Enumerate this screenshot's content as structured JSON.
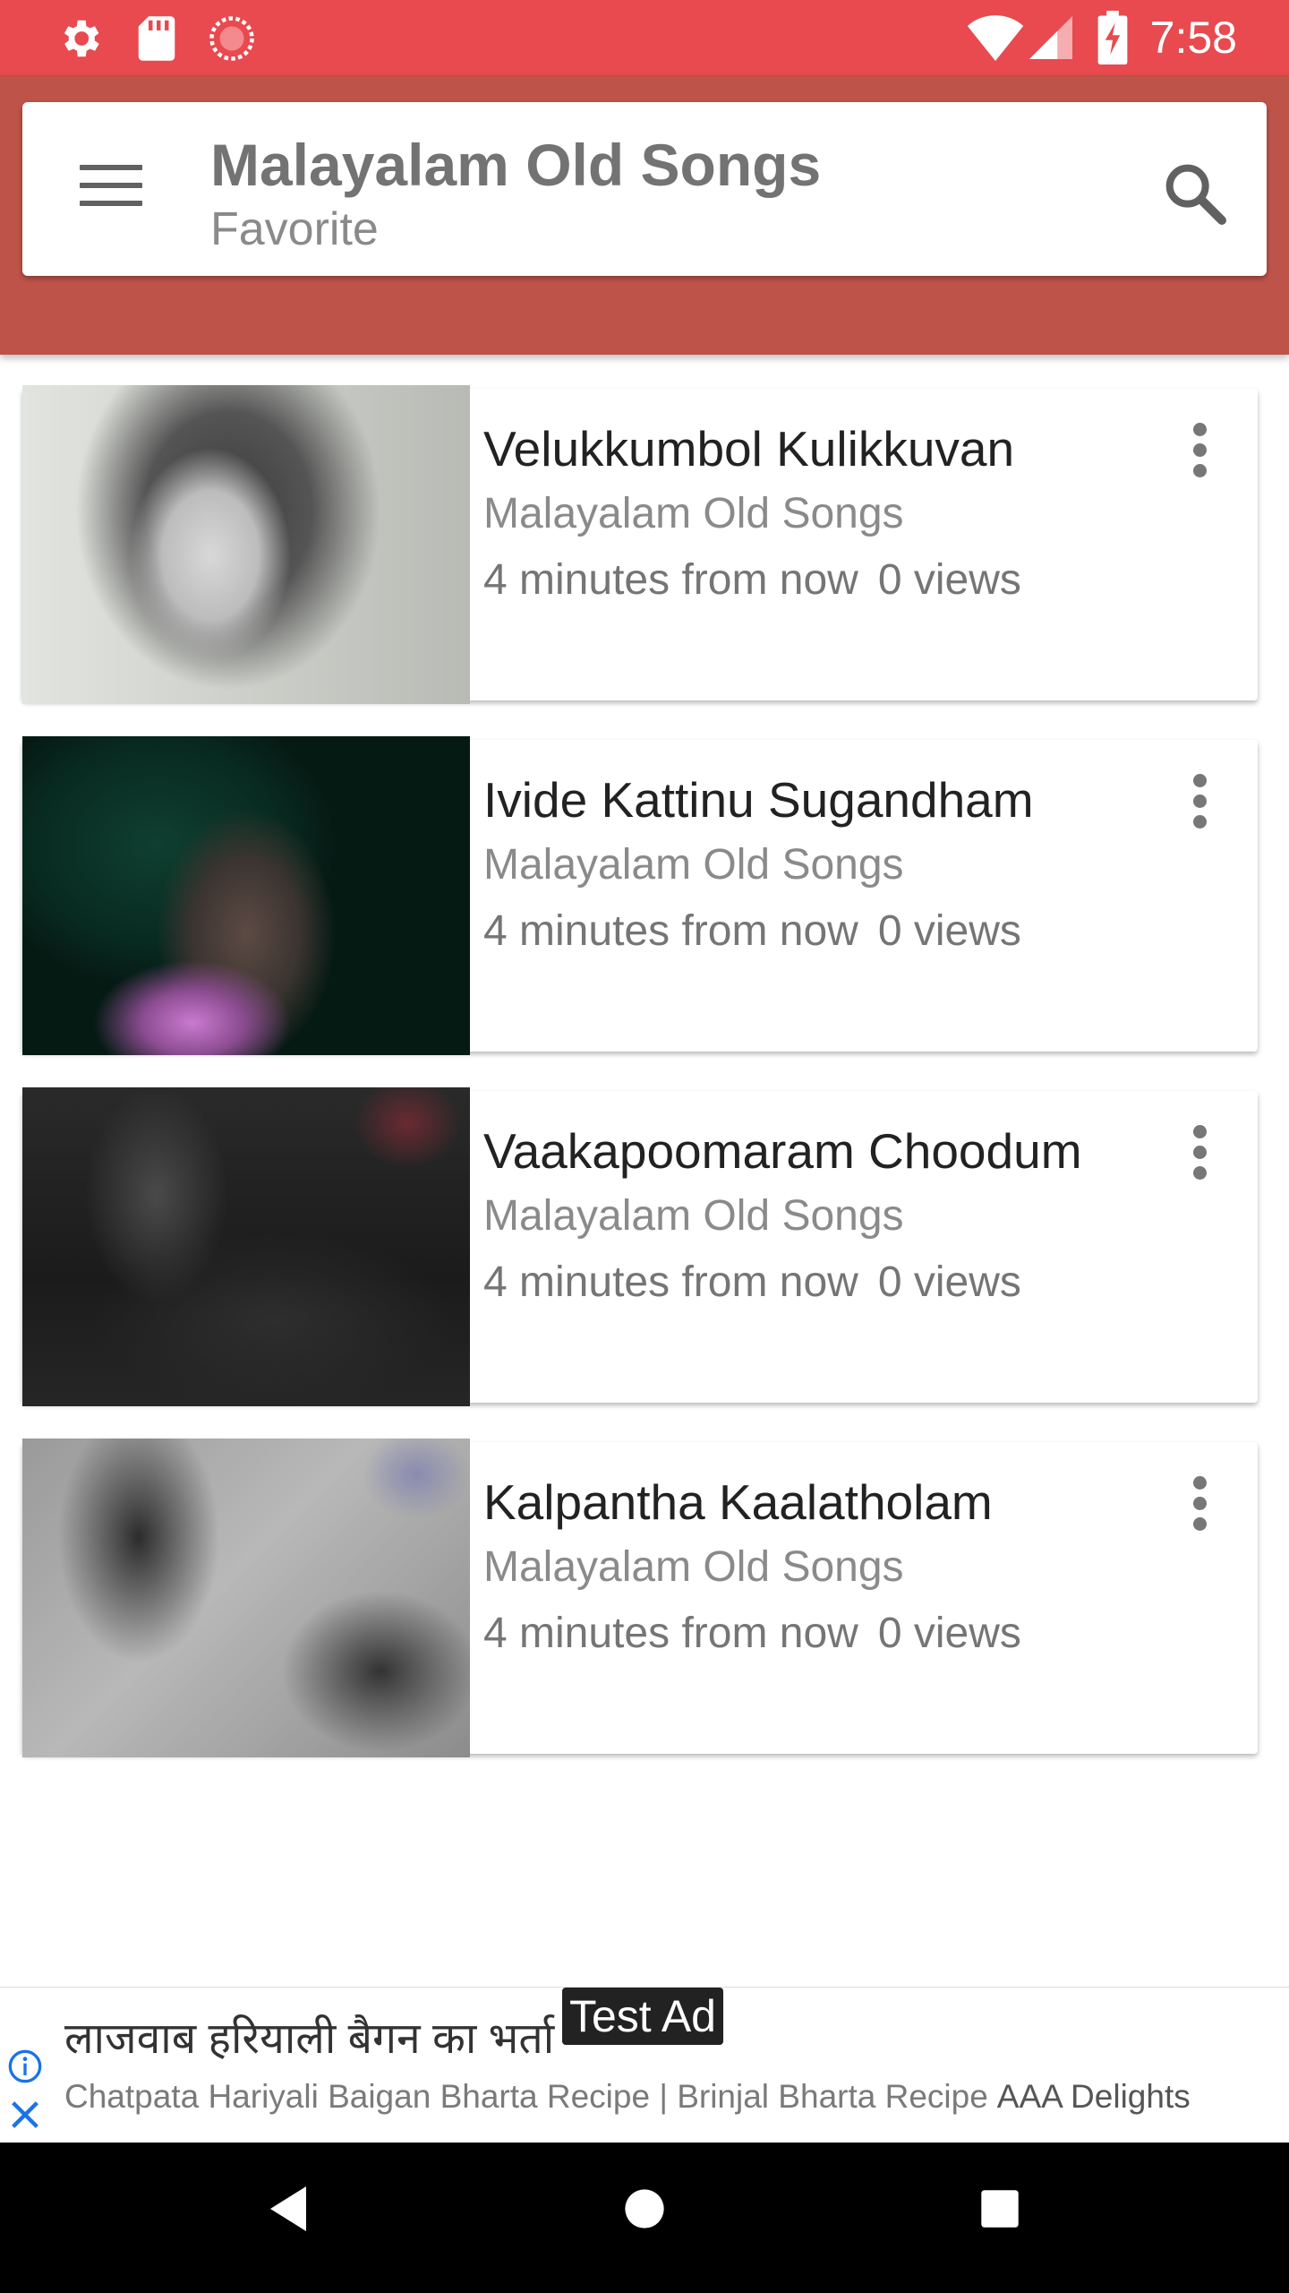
{
  "status_bar": {
    "time": "7:58",
    "icons": [
      "settings-icon",
      "sd-card-icon",
      "sync-icon",
      "wifi-icon",
      "signal-icon",
      "battery-charging-icon"
    ],
    "color": "#e84a4f"
  },
  "toolbar": {
    "title": "Malayalam Old Songs",
    "subtitle": "Favorite",
    "menu_icon": "hamburger-menu-icon",
    "search_icon": "search-icon",
    "band_color": "#bd5349"
  },
  "songs": [
    {
      "title": "Velukkumbol Kulikkuvan",
      "channel": "Malayalam Old Songs",
      "time": "4 minutes from now",
      "views": "0 views",
      "thumb": "bw-portrait"
    },
    {
      "title": "Ivide Kattinu Sugandham",
      "channel": "Malayalam Old Songs",
      "time": "4 minutes from now",
      "views": "0 views",
      "thumb": "green-scene"
    },
    {
      "title": "Vaakapoomaram Choodum",
      "channel": "Malayalam Old Songs",
      "time": "4 minutes from now",
      "views": "0 views",
      "thumb": "dark-scene"
    },
    {
      "title": "Kalpantha Kaalatholam",
      "channel": "Malayalam Old Songs",
      "time": "4 minutes from now",
      "views": "0 views",
      "thumb": "grey-scene"
    }
  ],
  "ad": {
    "badge": "Test Ad",
    "headline": "लाजवाब हरियाली बैगन का भर्ता",
    "description": "Chatpata Hariyali Baigan Bharta Recipe | Brinjal Bharta Recipe",
    "advertiser": "AAA Delights",
    "info_icon": "info-icon",
    "close_icon": "close-icon",
    "accent": "#1a73e8"
  },
  "nav_bar": {
    "icons": [
      "back-icon",
      "home-icon",
      "recents-icon"
    ]
  }
}
